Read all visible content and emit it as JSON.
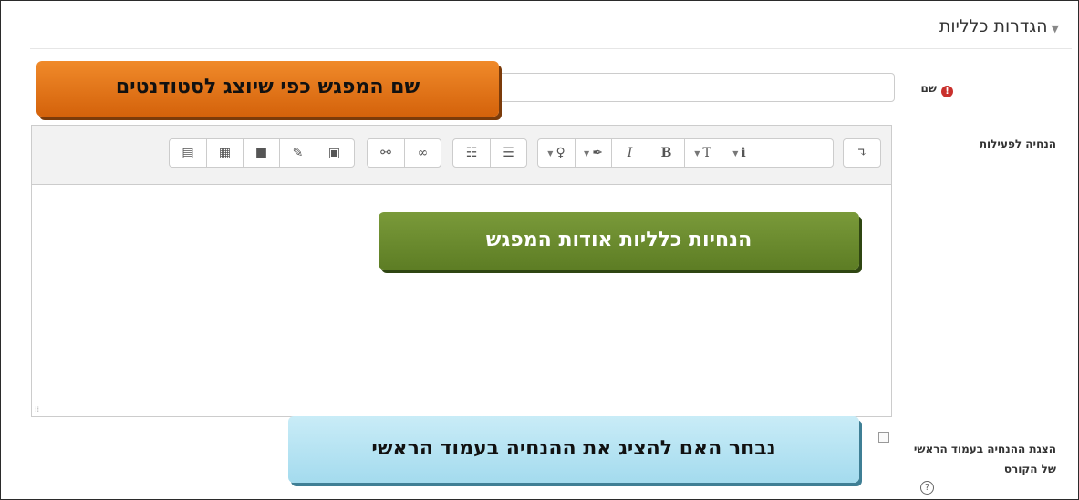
{
  "section": {
    "title": "הגדרות כלליות",
    "caret_icon": "triangle-down-icon"
  },
  "name_field": {
    "label": "שם",
    "required_icon": "!",
    "value": ""
  },
  "description_field": {
    "label": "הנחיה לפעילות"
  },
  "toolbar": {
    "groups": [
      [
        {
          "icon": "toggle-more-icon",
          "glyph": "⤵"
        }
      ],
      [
        {
          "icon": "info-dropdown-icon",
          "glyph": "i"
        },
        {
          "icon": "text-size-dropdown-icon",
          "glyph": "T"
        },
        {
          "icon": "bold-icon",
          "glyph": "B"
        },
        {
          "icon": "italic-icon",
          "glyph": "I"
        },
        {
          "icon": "brush-dropdown-icon",
          "glyph": "🖌"
        },
        {
          "icon": "lightbulb-dropdown-icon",
          "glyph": "💡"
        }
      ],
      [
        {
          "icon": "unordered-list-icon",
          "glyph": "☰"
        },
        {
          "icon": "ordered-list-icon",
          "glyph": "☷"
        }
      ],
      [
        {
          "icon": "link-icon",
          "glyph": "🔗"
        },
        {
          "icon": "unlink-icon",
          "glyph": "⛓"
        }
      ],
      [
        {
          "icon": "image-icon",
          "glyph": "▣"
        },
        {
          "icon": "pencil-icon",
          "glyph": "✎"
        },
        {
          "icon": "video-icon",
          "glyph": "■"
        },
        {
          "icon": "table-icon",
          "glyph": "▦"
        },
        {
          "icon": "audio-file-icon",
          "glyph": "🗎"
        }
      ]
    ]
  },
  "display_field": {
    "label": "הצגת ההנחיה בעמוד הראשי של הקורס",
    "checked": false,
    "help_icon": "?"
  },
  "callouts": {
    "name": "שם המפגש כפי שיוצג לסטודנטים",
    "description": "הנחיות כלליות אודות המפגש",
    "display": "נבחר האם להציג את ההנחיה בעמוד הראשי"
  }
}
